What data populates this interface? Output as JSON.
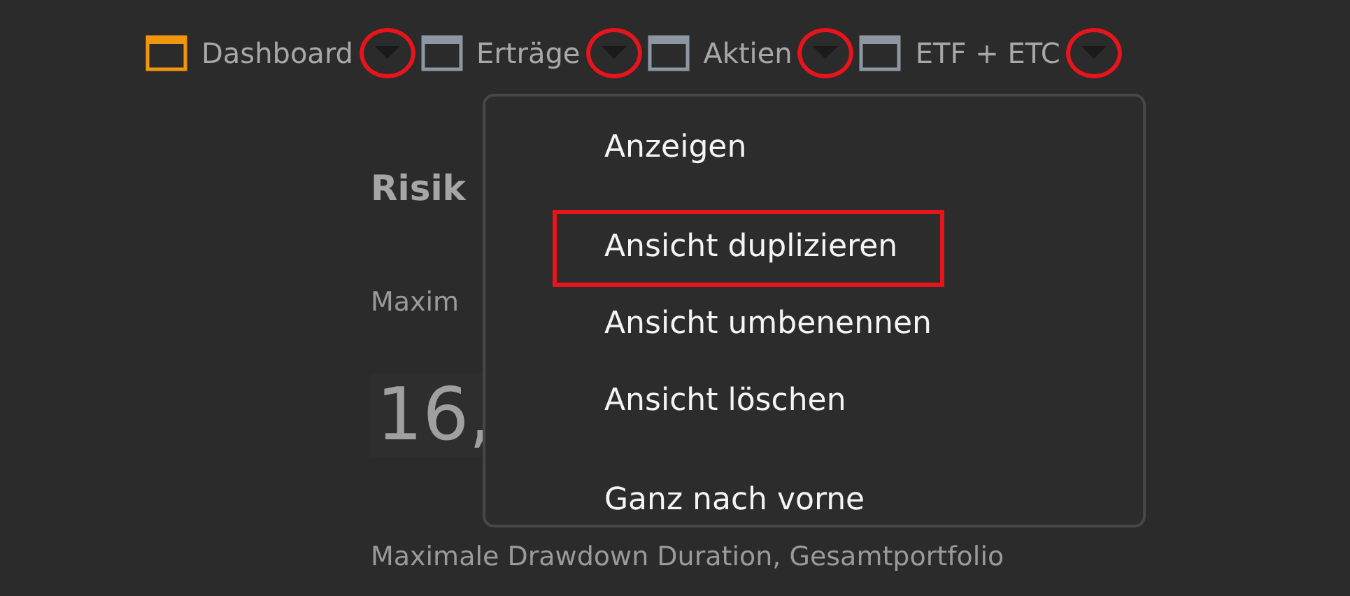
{
  "tabs": [
    {
      "label": "Dashboard",
      "selected": true,
      "caret_circled": true
    },
    {
      "label": "Erträge",
      "selected": false,
      "caret_circled": true
    },
    {
      "label": "Aktien",
      "selected": false,
      "caret_circled": true
    },
    {
      "label": "ETF + ETC",
      "selected": false,
      "caret_circled": true
    }
  ],
  "content": {
    "heading": "Risik",
    "metric_label": "Maxim",
    "metric_value": "16,",
    "footer_label": "Maximale Drawdown Duration, Gesamtportfolio"
  },
  "context_menu": {
    "items": [
      {
        "kind": "item",
        "label": "Anzeigen",
        "boxed": false
      },
      {
        "kind": "separator"
      },
      {
        "kind": "item",
        "label": "Ansicht duplizieren",
        "boxed": true
      },
      {
        "kind": "item",
        "label": "Ansicht umbenennen",
        "boxed": false
      },
      {
        "kind": "item",
        "label": "Ansicht löschen",
        "boxed": false
      },
      {
        "kind": "separator"
      },
      {
        "kind": "item",
        "label": "Ganz nach vorne",
        "boxed": false
      }
    ]
  }
}
